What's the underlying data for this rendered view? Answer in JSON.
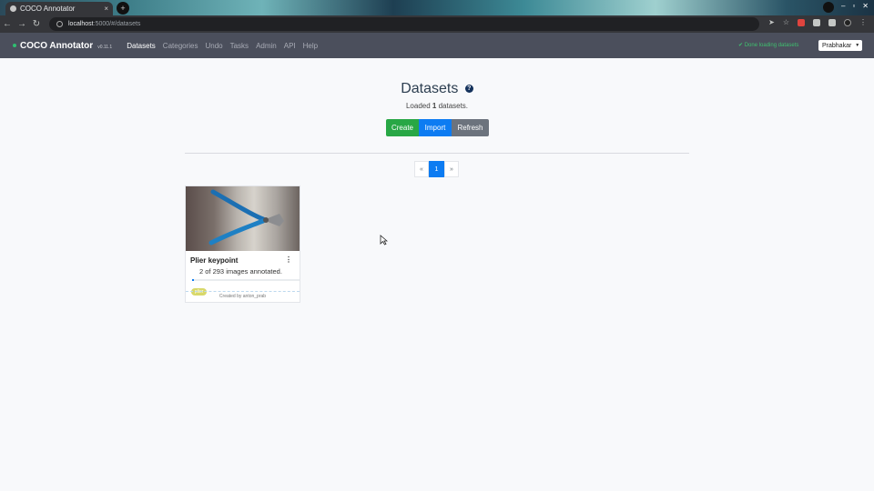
{
  "browser": {
    "tab_title": "COCO Annotator",
    "tab_close": "×",
    "new_tab": "+",
    "url_host": "localhost",
    "url_path": ":5000/#/datasets"
  },
  "navbar": {
    "brand": "COCO Annotator",
    "version": "v0.11.1",
    "links": [
      "Datasets",
      "Categories",
      "Undo",
      "Tasks",
      "Admin",
      "API",
      "Help"
    ],
    "active": "Datasets",
    "status": "✔ Done loading datasets",
    "user": "Prabhakar",
    "user_caret": "▼"
  },
  "page": {
    "title": "Datasets",
    "help_glyph": "?",
    "loaded_prefix": "Loaded ",
    "loaded_count": "1",
    "loaded_suffix": " datasets.",
    "buttons": {
      "create": "Create",
      "import": "Import",
      "refresh": "Refresh"
    },
    "pagination": {
      "prev": "«",
      "current": "1",
      "next": "»"
    }
  },
  "dataset_card": {
    "name": "Plier keypoint",
    "menu_glyph": "⋮",
    "annotated_text": "2 of 293 images annotated.",
    "annotated": 2,
    "total": 293,
    "tag": "plier",
    "footer": "Created by anton_prab"
  },
  "colors": {
    "navbar": "#4b4f5c",
    "create": "#28a745",
    "import": "#0d7cf2",
    "refresh": "#6c737d",
    "status": "#3fbf6f"
  }
}
